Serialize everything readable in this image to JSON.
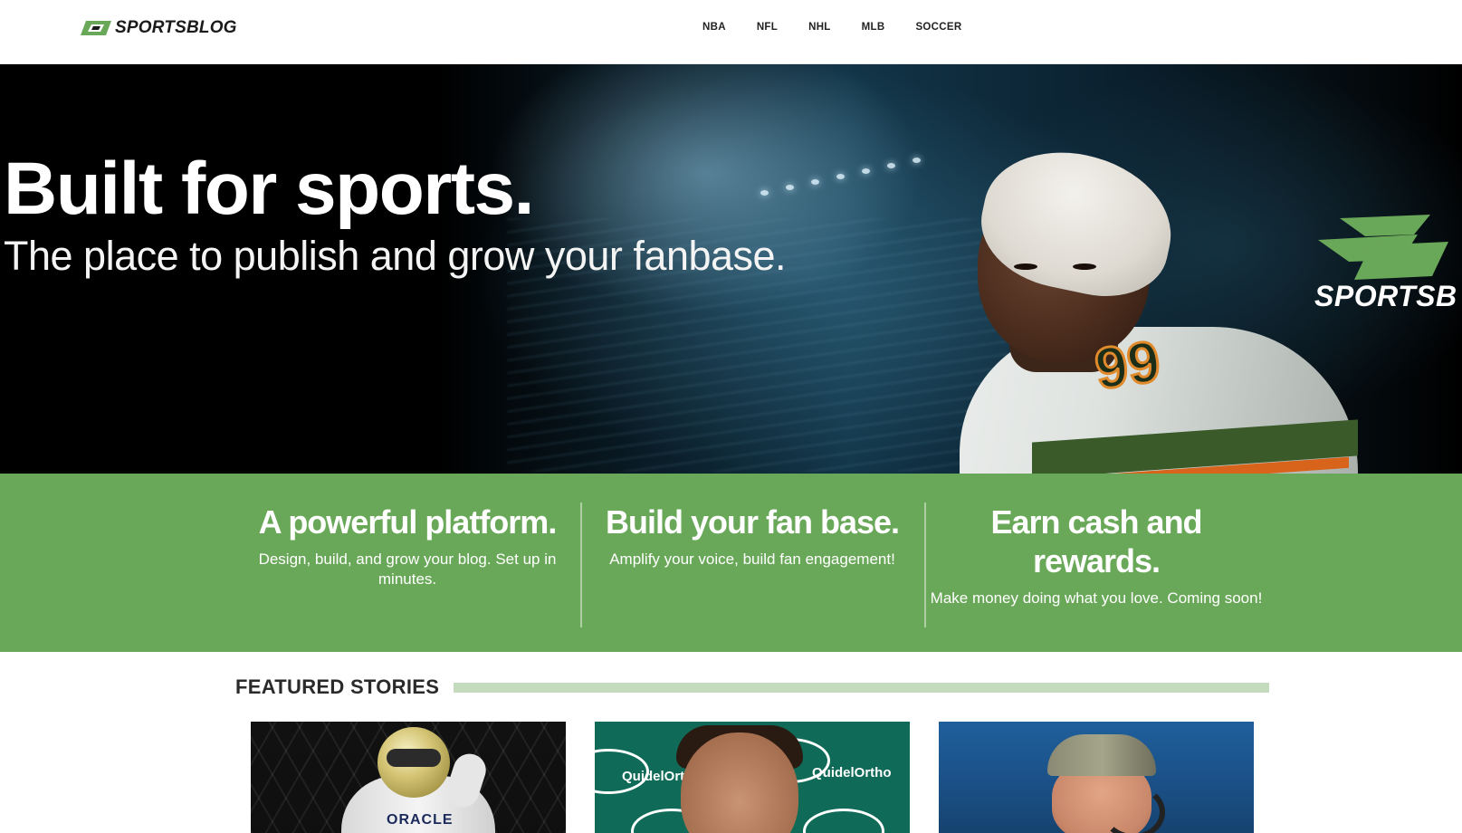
{
  "brand": {
    "name": "SPORTSBLOG",
    "accent_color": "#6aa859",
    "dark_color": "#1a1a1a"
  },
  "nav": {
    "items": [
      {
        "label": "NBA"
      },
      {
        "label": "NFL"
      },
      {
        "label": "NHL"
      },
      {
        "label": "MLB"
      },
      {
        "label": "SOCCER"
      }
    ]
  },
  "hero": {
    "title": "Built for sports.",
    "subtitle": "The place to publish and grow your fanbase.",
    "brand_overlay": "SPORTSB",
    "jersey_number": "99"
  },
  "features": [
    {
      "title": "A powerful platform.",
      "description": "Design, build, and grow your blog. Set up in minutes."
    },
    {
      "title": "Build your fan base.",
      "description": "Amplify your voice, build fan engagement!"
    },
    {
      "title": "Earn cash and rewards.",
      "description": "Make money doing what you love. Coming soon!"
    }
  ],
  "featured": {
    "heading": "FEATURED STORIES",
    "rule_color": "#c4dbbd",
    "stories": [
      {
        "image_subject": "racing-driver-celebrating",
        "image_text": "ORACLE"
      },
      {
        "image_subject": "press-conference",
        "image_text": "QuidelOrtho"
      },
      {
        "image_subject": "coach-with-headset",
        "image_text": ""
      }
    ]
  }
}
